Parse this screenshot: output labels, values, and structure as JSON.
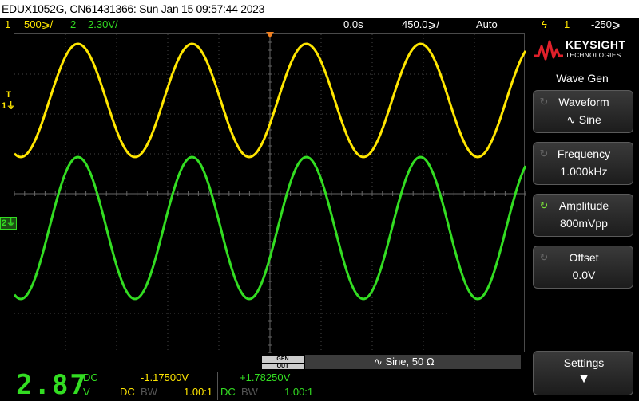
{
  "header": {
    "title": "EDUX1052G, CN61431366: Sun Jan 15 09:57:44 2023"
  },
  "status": {
    "ch1_num": "1",
    "ch1_scale": "500&#8203;&#8203;",
    "ch1_scale_text": "500̅̅/",
    "ch1_label": "500⩾/",
    "ch2_num": "2",
    "ch2_label": "2.30V/",
    "time_pos": "0.0s",
    "time_scale": "450.0⩾/",
    "trigger_mode": "Auto",
    "trigger_icon": "ϟ",
    "trigger_ch": "1",
    "trigger_level": "-250⩾"
  },
  "markers": {
    "ch1": "1",
    "ch2": "2",
    "trig_level": "T"
  },
  "sidebar": {
    "brand": "KEYSIGHT",
    "brand_sub": "TECHNOLOGIES",
    "menu_title": "Wave Gen",
    "softkeys": [
      {
        "label": "Waveform",
        "value": "∿ Sine",
        "active": false
      },
      {
        "label": "Frequency",
        "value": "1.000kHz",
        "active": false
      },
      {
        "label": "Amplitude",
        "value": "800mVpp",
        "active": true
      },
      {
        "label": "Offset",
        "value": "0.0V",
        "active": false
      }
    ],
    "settings_label": "Settings",
    "settings_arrow": "▼"
  },
  "wavegen": {
    "gen_out_l1": "GEN",
    "gen_out_l2": "OUT",
    "summary": "∿  Sine, 50 Ω"
  },
  "meter": {
    "big_value": "2.87",
    "unit_top": "DC",
    "unit_bottom": "V",
    "ch1_value": "-1.17500V",
    "ch2_value": "+1.78250V",
    "ch1_coupling": "DC",
    "ch1_bw": "BW",
    "ch1_probe": "1.00:1",
    "ch2_coupling": "DC",
    "ch2_bw": "BW",
    "ch2_probe": "1.00:1"
  },
  "colors": {
    "ch1": "#ffe600",
    "ch2": "#33dd22",
    "trigger": "#f08020"
  }
}
